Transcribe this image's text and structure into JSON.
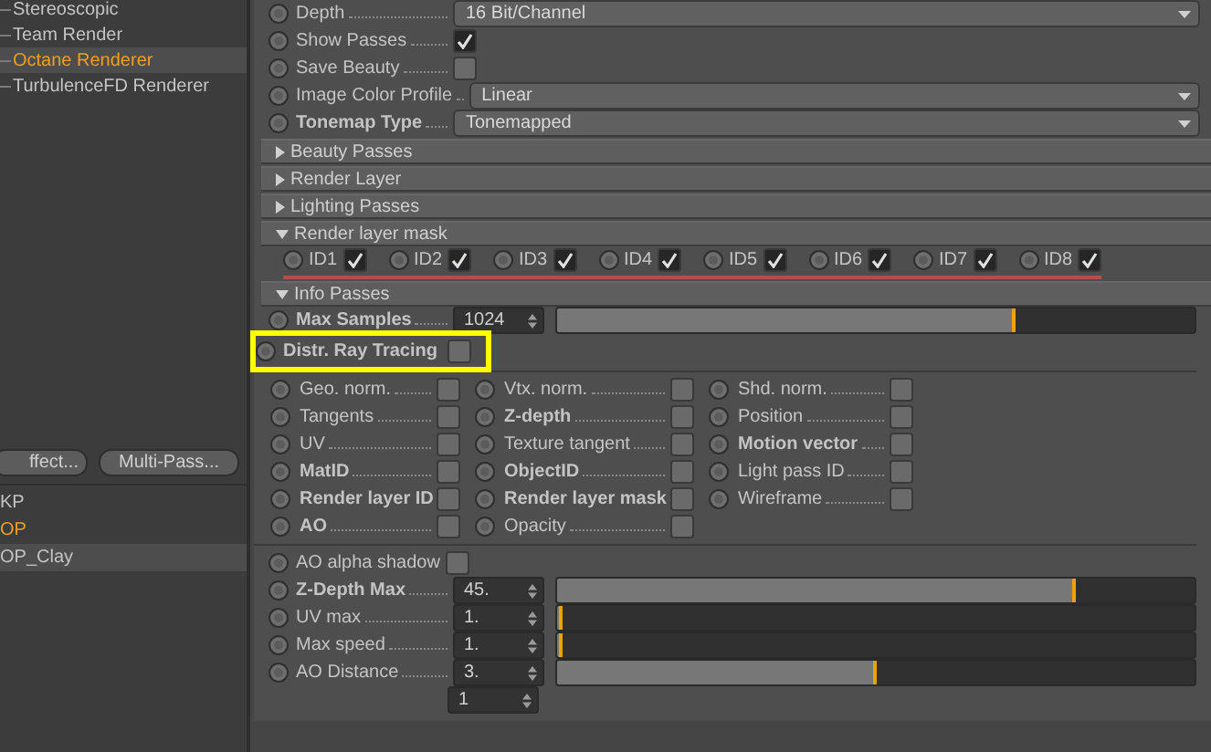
{
  "sidebar": {
    "tree_items": [
      {
        "label": "Stereoscopic",
        "selected": false,
        "active": false
      },
      {
        "label": "Team Render",
        "selected": false,
        "active": false
      },
      {
        "label": "Octane Renderer",
        "selected": true,
        "active": true
      },
      {
        "label": "TurbulenceFD Renderer",
        "selected": false,
        "active": false
      }
    ],
    "buttons": [
      "ffect...",
      "Multi-Pass..."
    ],
    "list_items": [
      {
        "label": "KP",
        "selected": false,
        "active": false
      },
      {
        "label": "OP",
        "selected": false,
        "active": true
      },
      {
        "label": "OP_Clay",
        "selected": true,
        "active": false
      }
    ]
  },
  "settings": [
    {
      "kind": "dropdown",
      "label": "Depth",
      "bold": false,
      "value": "16 Bit/Channel"
    },
    {
      "kind": "checkbox",
      "label": "Show Passes",
      "bold": false,
      "checked": true
    },
    {
      "kind": "checkbox",
      "label": "Save Beauty",
      "bold": false,
      "checked": false
    },
    {
      "kind": "dropdown",
      "label": "Image Color Profile",
      "bold": false,
      "value": "Linear"
    },
    {
      "kind": "dropdown",
      "label": "Tonemap Type",
      "bold": true,
      "value": "Tonemapped"
    }
  ],
  "groups": [
    {
      "label": "Beauty Passes",
      "expanded": false
    },
    {
      "label": "Render Layer",
      "expanded": false
    },
    {
      "label": "Lighting Passes",
      "expanded": false
    },
    {
      "label": "Render layer mask",
      "expanded": true,
      "ids": [
        {
          "label": "ID1",
          "checked": true
        },
        {
          "label": "ID2",
          "checked": true
        },
        {
          "label": "ID3",
          "checked": true
        },
        {
          "label": "ID4",
          "checked": true
        },
        {
          "label": "ID5",
          "checked": true
        },
        {
          "label": "ID6",
          "checked": true
        },
        {
          "label": "ID7",
          "checked": true
        },
        {
          "label": "ID8",
          "checked": true
        }
      ]
    }
  ],
  "info_passes": {
    "label": "Info Passes",
    "expanded": true,
    "rows": [
      {
        "kind": "slider",
        "label": "Max Samples",
        "bold": true,
        "value": "1024",
        "level": 0.72
      },
      {
        "kind": "checkbox",
        "label": "Distr. Ray Tracing",
        "bold": true,
        "checked": false,
        "highlighted": true
      },
      {
        "kind": "grid",
        "passes": [
          {
            "label": "Geo. norm.",
            "bold": false,
            "checked": false
          },
          {
            "label": "Vtx. norm.",
            "bold": false,
            "checked": false
          },
          {
            "label": "Shd. norm.",
            "bold": false,
            "checked": false
          },
          {
            "label": "Tangents",
            "bold": false,
            "checked": false
          },
          {
            "label": "Z-depth",
            "bold": true,
            "checked": false
          },
          {
            "label": "Position",
            "bold": false,
            "checked": false
          },
          {
            "label": "UV",
            "bold": false,
            "checked": false
          },
          {
            "label": "Texture tangent",
            "bold": false,
            "checked": false
          },
          {
            "label": "Motion vector",
            "bold": true,
            "checked": false
          },
          {
            "label": "MatID",
            "bold": true,
            "checked": false
          },
          {
            "label": "ObjectID",
            "bold": true,
            "checked": false
          },
          {
            "label": "Light pass ID",
            "bold": false,
            "checked": false
          },
          {
            "label": "Render layer ID",
            "bold": true,
            "checked": false
          },
          {
            "label": "Render layer mask",
            "bold": true,
            "checked": false
          },
          {
            "label": "Wireframe",
            "bold": false,
            "checked": false
          },
          {
            "label": "AO",
            "bold": true,
            "checked": false
          },
          {
            "label": "Opacity",
            "bold": false,
            "checked": false
          }
        ]
      },
      {
        "kind": "checkbox",
        "label": "AO alpha shadow",
        "bold": false,
        "checked": false
      },
      {
        "kind": "slider",
        "label": "Z-Depth Max",
        "bold": true,
        "value": "45.",
        "level": 0.815
      },
      {
        "kind": "slider",
        "label": "UV max",
        "bold": false,
        "value": "1.",
        "level": 0.01
      },
      {
        "kind": "slider",
        "label": "Max speed",
        "bold": false,
        "value": "1.",
        "level": 0.01
      },
      {
        "kind": "slider",
        "label": "AO Distance",
        "bold": false,
        "value": "3.",
        "level": 0.5
      },
      {
        "kind": "number",
        "value": "1"
      }
    ]
  }
}
